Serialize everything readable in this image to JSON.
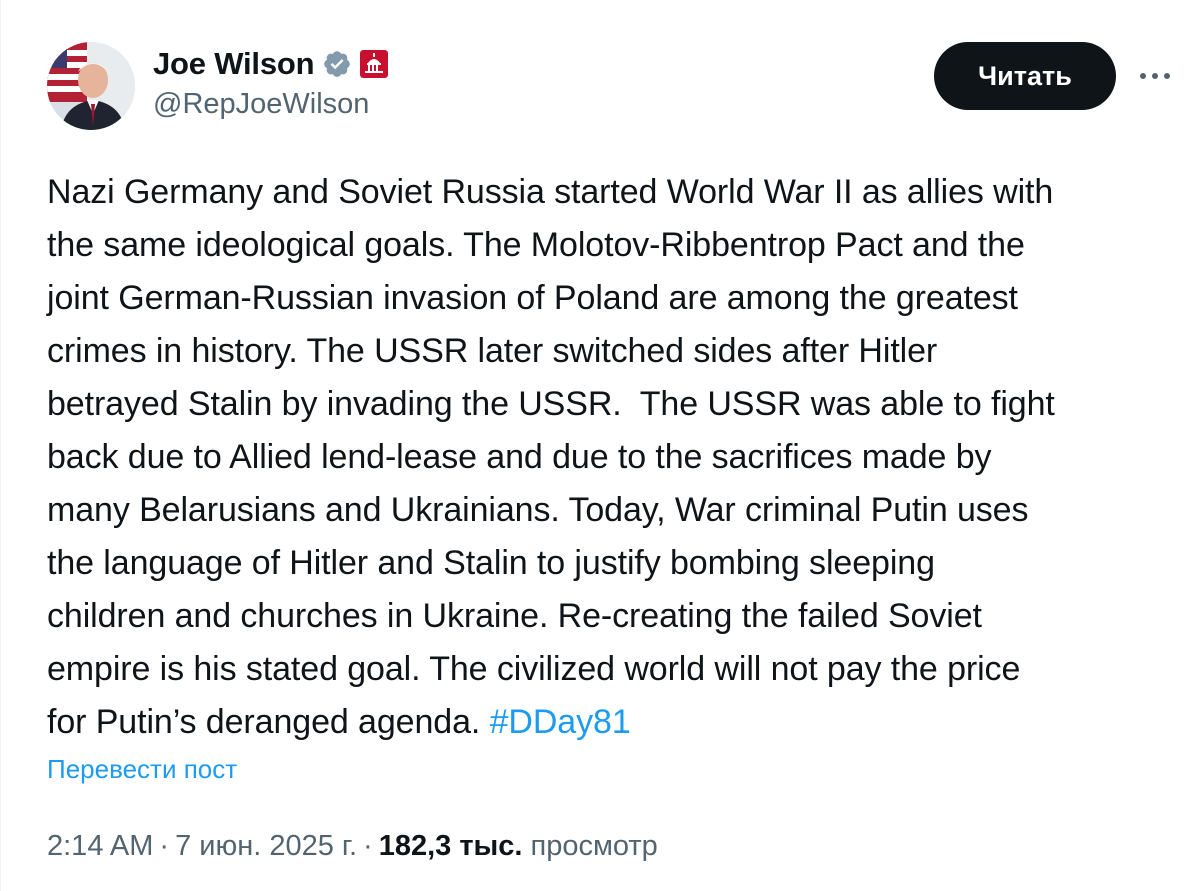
{
  "author": {
    "display_name": "Joe Wilson",
    "handle": "@RepJoeWilson",
    "verified_icon": "verified-badge-icon",
    "affiliation_icon": "us-capitol-icon"
  },
  "actions": {
    "follow_label": "Читать",
    "more_icon": "more-horizontal-icon"
  },
  "tweet": {
    "text": "Nazi Germany and Soviet Russia started World War II as allies with\nthe same ideological goals. The Molotov-Ribbentrop Pact and the\njoint German-Russian invasion of Poland are among the greatest\ncrimes in history. The USSR later switched sides after Hitler\nbetrayed Stalin by invading the USSR.  The USSR was able to fight\nback due to Allied lend-lease and due to the sacrifices made by\nmany Belarusians and Ukrainians. Today, War criminal Putin uses\nthe language of Hitler and Stalin to justify bombing sleeping\nchildren and churches in Ukraine. Re-creating the failed Soviet\nempire is his stated goal. The civilized world will not pay the price\nfor Putin’s deranged agenda. ",
    "hashtag": "#DDay81",
    "translate_label": "Перевести пост"
  },
  "meta": {
    "time": "2:14 AM",
    "separator": "·",
    "date": "7 июн. 2025 г.",
    "views_count": "182,3 тыс.",
    "views_label": "просмотр"
  },
  "colors": {
    "text": "#0f1419",
    "secondary": "#536471",
    "link": "#1d9bf0",
    "button_bg": "#0f1419",
    "verified_badge": "#829aab",
    "affiliation_bg": "#c8102e"
  }
}
